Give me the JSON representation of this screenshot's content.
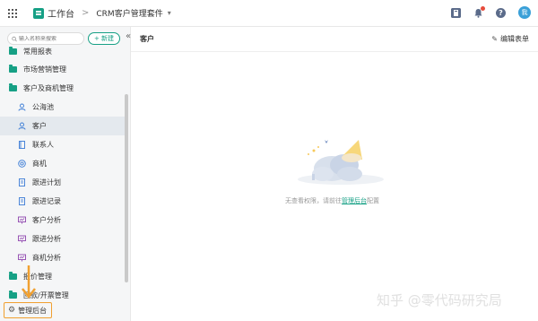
{
  "topbar": {
    "workbench_label": "工作台",
    "separator": ">",
    "app_name": "CRM客户管理套件",
    "caret": "▾",
    "help_glyph": "?",
    "avatar_text": "我"
  },
  "sidebar": {
    "search_placeholder": "输入名称来搜索",
    "new_label": "+ 新建",
    "collapse_glyph": "«",
    "items": [
      {
        "label": "常用报表",
        "type": "group"
      },
      {
        "label": "市场营销管理",
        "type": "group"
      },
      {
        "label": "客户及商机管理",
        "type": "group"
      },
      {
        "label": "公海池",
        "type": "child",
        "icon": "users-icon"
      },
      {
        "label": "客户",
        "type": "child",
        "icon": "user-icon",
        "active": true
      },
      {
        "label": "联系人",
        "type": "child",
        "icon": "contact-icon"
      },
      {
        "label": "商机",
        "type": "child",
        "icon": "target-icon"
      },
      {
        "label": "跟进计划",
        "type": "child",
        "icon": "doc-icon"
      },
      {
        "label": "跟进记录",
        "type": "child",
        "icon": "doc-icon"
      },
      {
        "label": "客户分析",
        "type": "child",
        "icon": "chart-icon"
      },
      {
        "label": "跟进分析",
        "type": "child",
        "icon": "chart-icon"
      },
      {
        "label": "商机分析",
        "type": "child",
        "icon": "chart-icon"
      },
      {
        "label": "报价管理",
        "type": "group"
      },
      {
        "label": "回款/开票管理",
        "type": "group"
      }
    ],
    "admin_label": "管理后台"
  },
  "main": {
    "title": "客户",
    "edit_form_label": "编辑表单",
    "empty_prefix": "无查看权限，请前往",
    "empty_link": "管理后台",
    "empty_suffix": "配置"
  },
  "watermark": "知乎 @零代码研究局",
  "colors": {
    "accent": "#16a085",
    "highlight": "#f0a030"
  }
}
